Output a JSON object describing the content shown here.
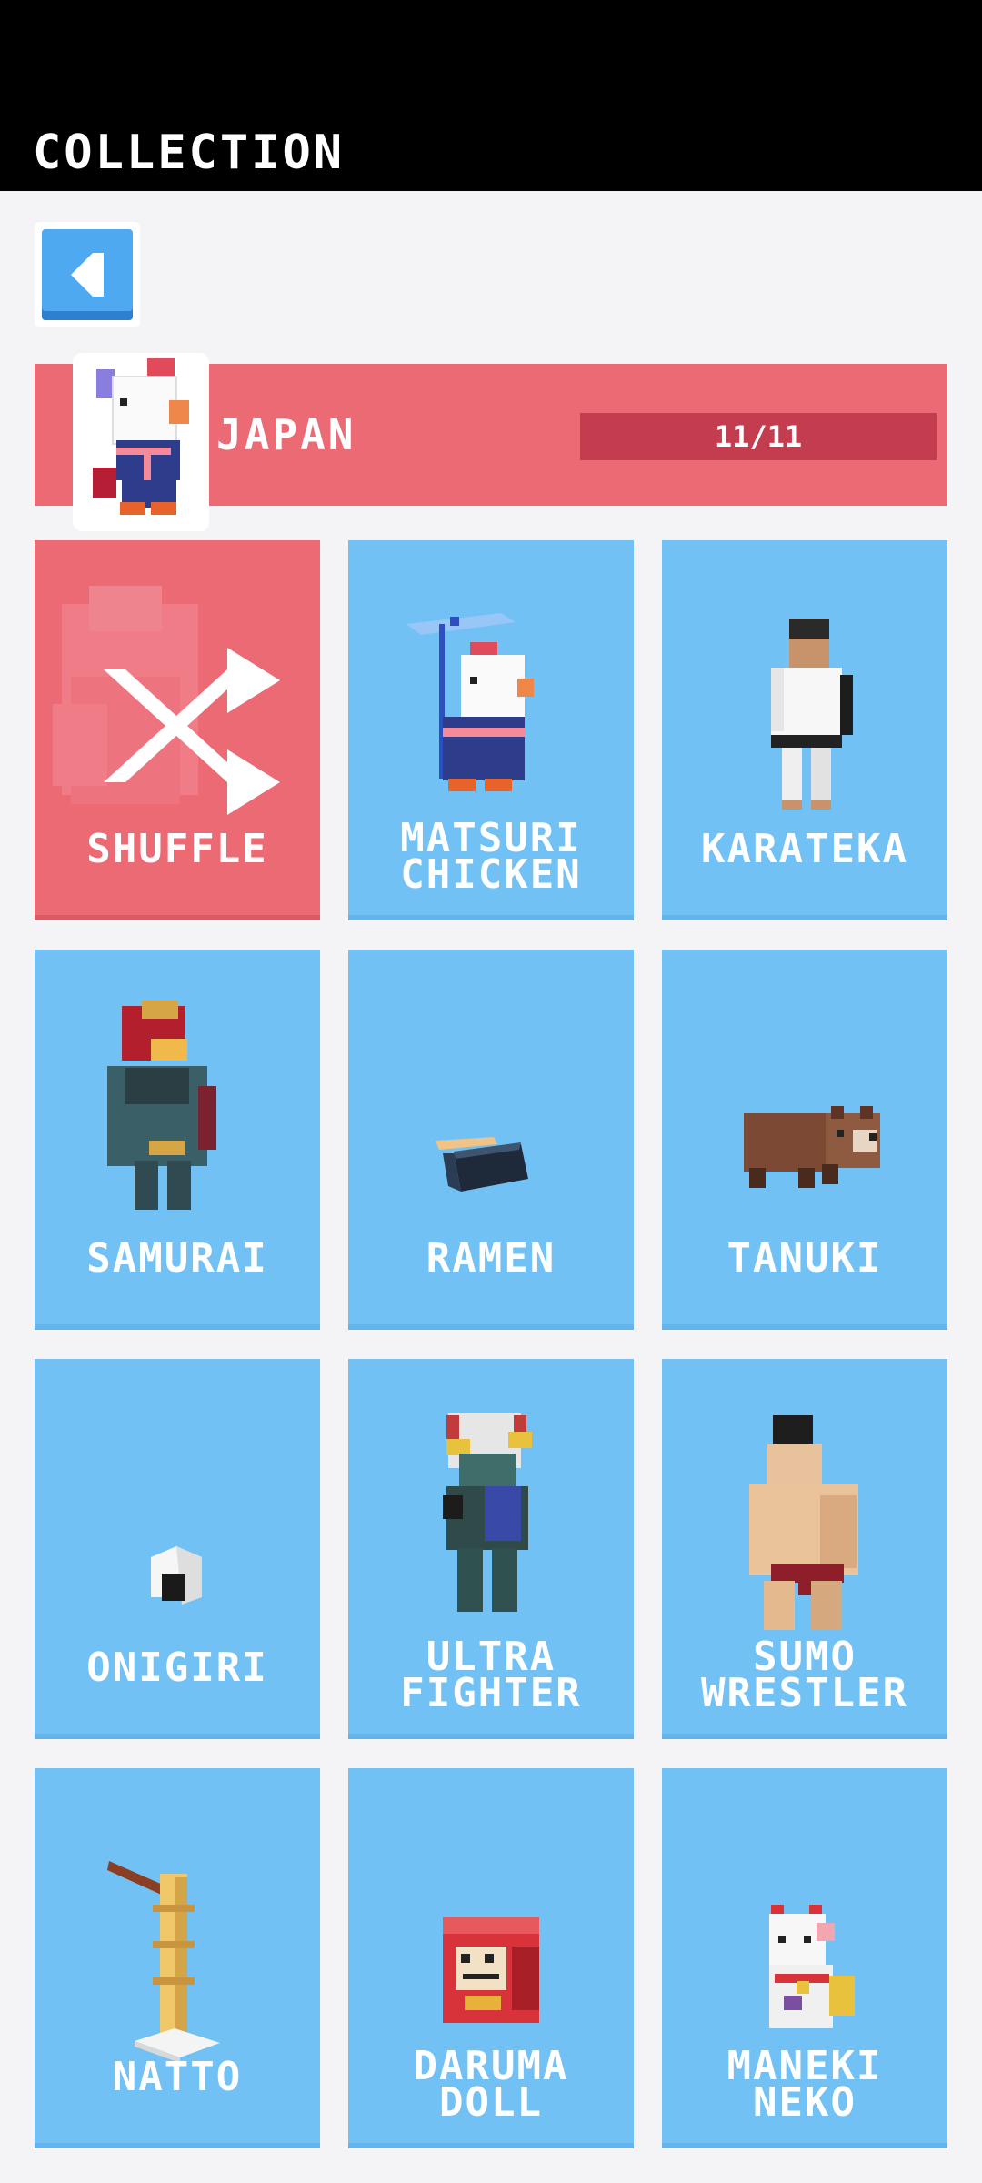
{
  "header": {
    "title": "COLLECTION"
  },
  "back_button": {
    "icon": "back-arrow-icon"
  },
  "region": {
    "name": "JAPAN",
    "progress_text": "11/11",
    "progress_fraction": 1.0
  },
  "colors": {
    "card_blue": "#72c1f4",
    "shuffle_red": "#eb6a74",
    "banner_red": "#eb6a74",
    "progress_dark": "#c43d4e"
  },
  "characters": [
    {
      "name": "SHUFFLE",
      "icon": "shuffle-icon"
    },
    {
      "name": "MATSURI CHICKEN",
      "icon": "matsuri-chicken-icon"
    },
    {
      "name": "KARATEKA",
      "icon": "karateka-icon"
    },
    {
      "name": "SAMURAI",
      "icon": "samurai-icon"
    },
    {
      "name": "RAMEN",
      "icon": "ramen-icon"
    },
    {
      "name": "TANUKI",
      "icon": "tanuki-icon"
    },
    {
      "name": "ONIGIRI",
      "icon": "onigiri-icon"
    },
    {
      "name": "ULTRA FIGHTER",
      "icon": "ultra-fighter-icon"
    },
    {
      "name": "SUMO WRESTLER",
      "icon": "sumo-wrestler-icon"
    },
    {
      "name": "NATTO",
      "icon": "natto-icon"
    },
    {
      "name": "DARUMA DOLL",
      "icon": "daruma-doll-icon"
    },
    {
      "name": "MANEKI NEKO",
      "icon": "maneki-neko-icon"
    }
  ]
}
